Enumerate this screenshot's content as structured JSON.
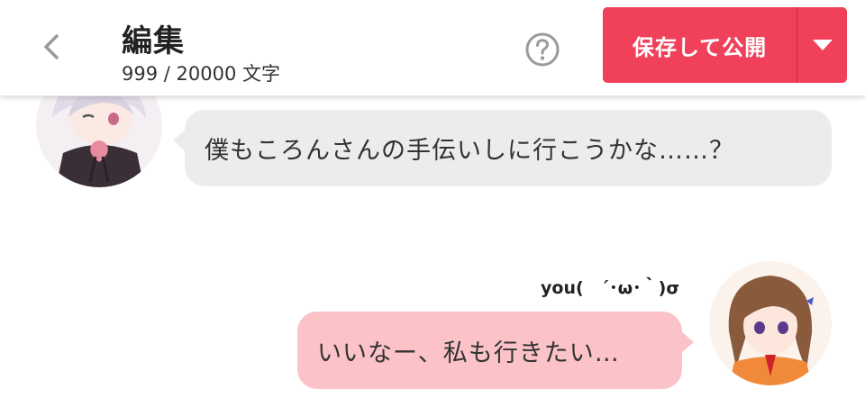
{
  "header": {
    "title": "編集",
    "char_count": "999 / 20000 文字",
    "publish_label": "保存して公開",
    "colors": {
      "accent": "#f0405a"
    },
    "icons": {
      "back": "chevron-left-icon",
      "help": "question-circle-icon",
      "dropdown": "caret-down-icon"
    }
  },
  "messages": [
    {
      "side": "left",
      "text": "僕もころんさんの手伝いしに行こうかな……？",
      "bubble_color": "#ececec"
    },
    {
      "side": "right",
      "speaker": "you(　´･ω･｀)σ",
      "text": "いいなー、私も行きたい…",
      "bubble_color": "#fbc2c8"
    }
  ]
}
